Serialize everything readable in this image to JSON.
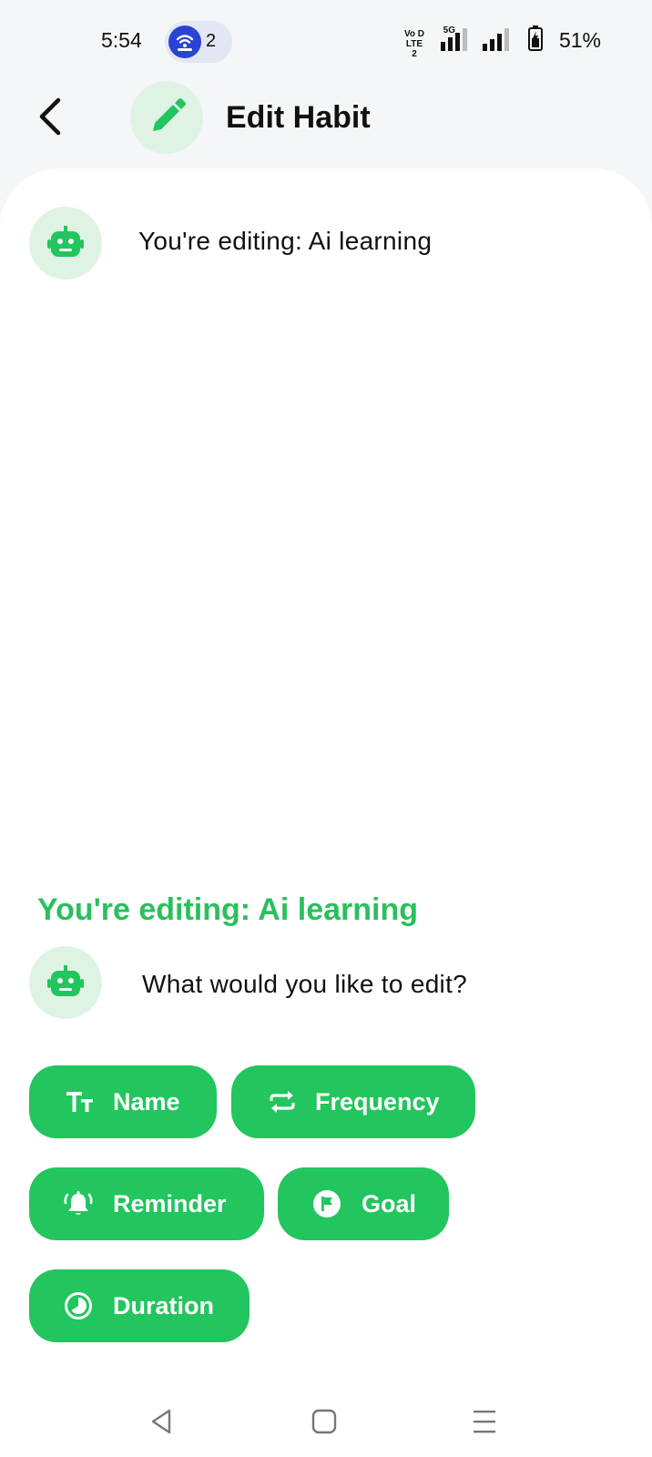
{
  "status_bar": {
    "time": "5:54",
    "notification_count": "2",
    "network_type": "5G",
    "volte_label": "Vo D LTE 2",
    "battery": "51%"
  },
  "header": {
    "title": "Edit Habit",
    "back_icon": "chevron-left-icon",
    "title_icon": "pencil-icon"
  },
  "chat": {
    "first_message": "You're editing: Ai learning",
    "section_title": "You're editing: Ai learning",
    "question": "What would you like to edit?"
  },
  "options": [
    {
      "label": "Name",
      "icon": "text-size-icon"
    },
    {
      "label": "Frequency",
      "icon": "repeat-icon"
    },
    {
      "label": "Reminder",
      "icon": "bell-ring-icon"
    },
    {
      "label": "Goal",
      "icon": "flag-circle-icon"
    },
    {
      "label": "Duration",
      "icon": "clock-circle-icon"
    }
  ],
  "colors": {
    "accent": "#22c55e",
    "accent_text": "#2bbf5d",
    "avatar_bg": "#dff3e5",
    "page_bg": "#f5f6f8",
    "card_bg": "#ffffff"
  }
}
